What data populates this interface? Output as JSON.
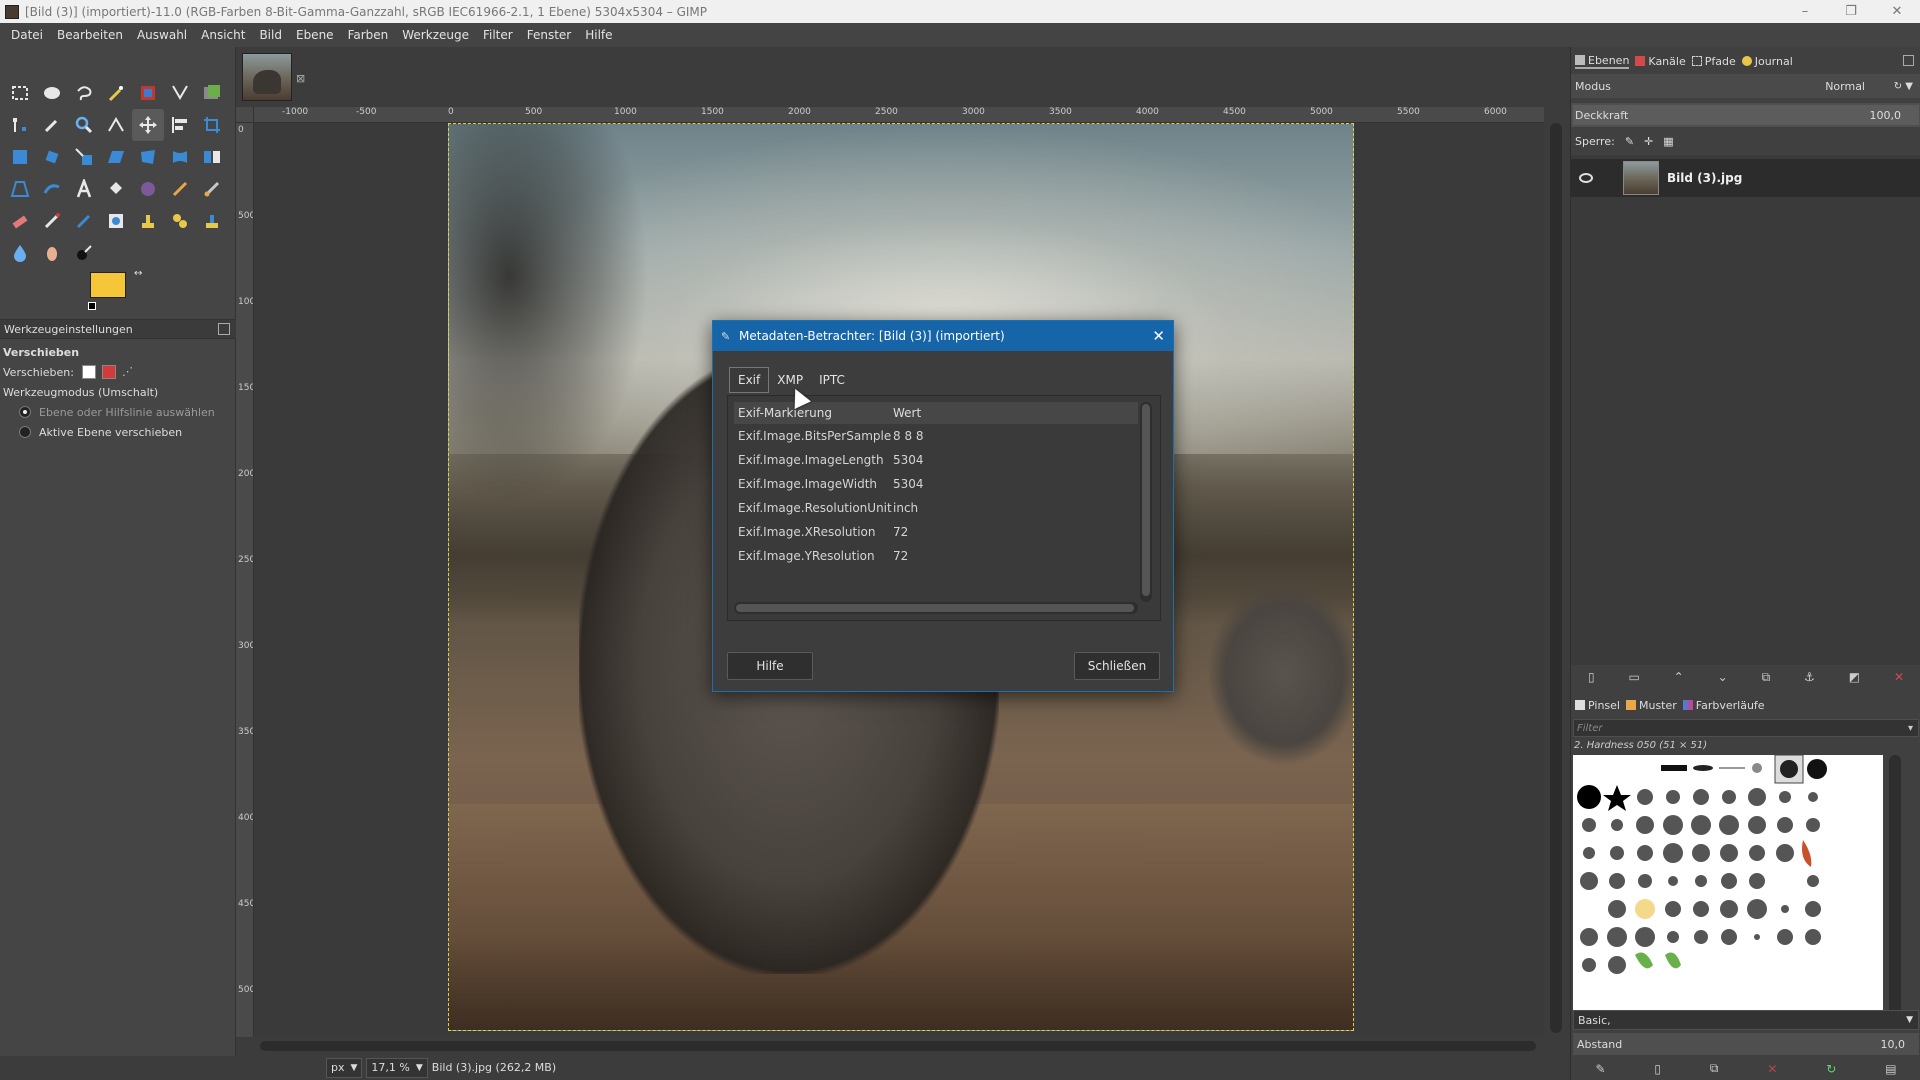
{
  "window": {
    "title": "[Bild (3)] (importiert)-11.0 (RGB-Farben 8-Bit-Gamma-Ganzzahl, sRGB IEC61966-2.1, 1 Ebene) 5304x5304 – GIMP",
    "minimize": "–",
    "maximize": "❐",
    "close": "✕"
  },
  "menubar": {
    "items": [
      "Datei",
      "Bearbeiten",
      "Auswahl",
      "Ansicht",
      "Bild",
      "Ebene",
      "Farben",
      "Werkzeuge",
      "Filter",
      "Fenster",
      "Hilfe"
    ]
  },
  "colors": {
    "foreground": "#f5c637",
    "background": "#ffffff",
    "swap_glyph": "↔"
  },
  "tool_options": {
    "tab_label": "Werkzeugeinstellungen",
    "tool_name": "Verschieben",
    "move_label": "Verschieben:",
    "mode_label": "Werkzeugmodus (Umschalt)",
    "radio_1": "Ebene oder Hilfslinie auswählen",
    "radio_2": "Aktive Ebene verschieben",
    "radio_1_checked": true,
    "radio_2_checked": false
  },
  "image_tab": {
    "close_glyph": "⊠"
  },
  "rulers": {
    "top_labels": [
      "-1000",
      "-500",
      "0",
      "500",
      "1000",
      "1500",
      "2000",
      "2500",
      "3000",
      "3500",
      "4000",
      "4500",
      "5000",
      "5500",
      "6000"
    ],
    "left_labels": [
      "0",
      "500",
      "1000",
      "1500",
      "2000",
      "2500",
      "3000",
      "3500",
      "4000",
      "4500",
      "5000"
    ]
  },
  "metadata_dialog": {
    "title": "Metadaten-Betrachter: [Bild (3)] (importiert)",
    "close_glyph": "✕",
    "tabs": [
      "Exif",
      "XMP",
      "IPTC"
    ],
    "selected_tab": "Exif",
    "columns": [
      "Exif-Markierung",
      "Wert"
    ],
    "rows": [
      [
        "Exif.Image.BitsPerSample",
        "8 8 8"
      ],
      [
        "Exif.Image.ImageLength",
        "5304"
      ],
      [
        "Exif.Image.ImageWidth",
        "5304"
      ],
      [
        "Exif.Image.ResolutionUnit",
        "inch"
      ],
      [
        "Exif.Image.XResolution",
        "72"
      ],
      [
        "Exif.Image.YResolution",
        "72"
      ]
    ],
    "help_button": "Hilfe",
    "close_button": "Schließen"
  },
  "statusbar": {
    "unit": "px",
    "zoom": "17,1 %",
    "info": "Bild (3).jpg (262,2 MB)"
  },
  "dock": {
    "tabs": [
      "Ebenen",
      "Kanäle",
      "Pfade",
      "Journal"
    ],
    "mode_label": "Modus",
    "mode_value": "Normal",
    "opacity_label": "Deckkraft",
    "opacity_value": "100,0",
    "lock_label": "Sperre:",
    "layer_name": "Bild (3).jpg",
    "brush_tabs": [
      "Pinsel",
      "Muster",
      "Farbverläufe"
    ],
    "filter_placeholder": "Filter",
    "brush_name": "2. Hardness 050 (51 × 51)",
    "preset": "Basic,",
    "spacing_label": "Abstand",
    "spacing_value": "10,0"
  }
}
